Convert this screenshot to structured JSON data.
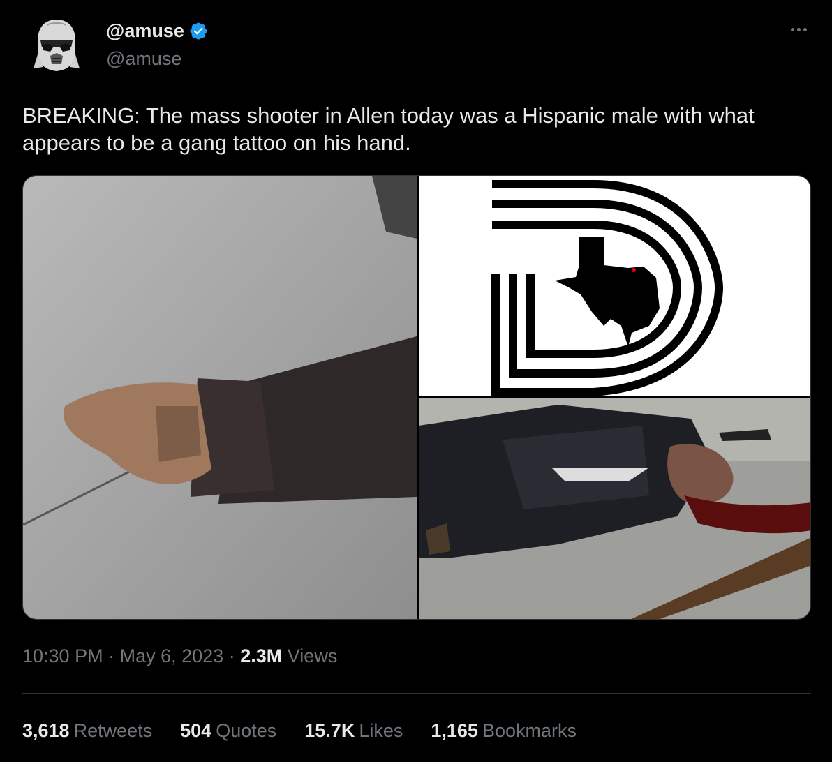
{
  "author": {
    "display_name": "@amuse",
    "handle": "@amuse",
    "verified": true,
    "avatar_icon": "stormtrooper-helmet-avatar"
  },
  "tweet": {
    "text": "BREAKING: The mass shooter in Allen today was a Hispanic male with what appears to be a gang tattoo on his hand."
  },
  "media": {
    "images": [
      {
        "name": "hand-tattoo-photo"
      },
      {
        "name": "dallas-d-logo-texas-map"
      },
      {
        "name": "suspect-on-ground-photo"
      }
    ]
  },
  "meta": {
    "time": "10:30 PM",
    "separator": "·",
    "date": "May 6, 2023",
    "views_count": "2.3M",
    "views_label": "Views"
  },
  "stats": {
    "retweets": {
      "count": "3,618",
      "label": "Retweets"
    },
    "quotes": {
      "count": "504",
      "label": "Quotes"
    },
    "likes": {
      "count": "15.7K",
      "label": "Likes"
    },
    "bookmarks": {
      "count": "1,165",
      "label": "Bookmarks"
    }
  },
  "colors": {
    "background": "#000000",
    "text_primary": "#e7e9ea",
    "text_secondary": "#71767b",
    "verified_blue": "#1d9bf0",
    "divider": "#2f3336"
  }
}
